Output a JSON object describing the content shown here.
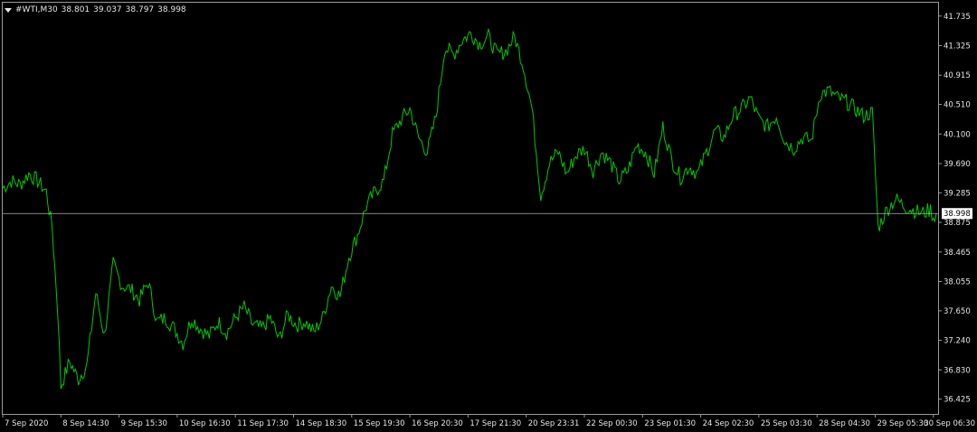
{
  "header": {
    "symbol": "#WTI,M30",
    "ohlc": [
      "38.801",
      "39.037",
      "38.797",
      "38.998"
    ]
  },
  "colors": {
    "background": "#000000",
    "series": "#00c800",
    "text": "#e6e6e6",
    "frame": "#9a9a9a",
    "bid_line": "#b4b4b4",
    "price_tag_bg": "#ffffff",
    "price_tag_text": "#000000"
  },
  "chart_data": {
    "type": "line",
    "title": "#WTI,M30",
    "y_axis_position": "right",
    "grid": false,
    "ylim": [
      36.22,
      41.92
    ],
    "y_ticks": [
      41.735,
      41.325,
      40.915,
      40.51,
      40.1,
      39.69,
      39.285,
      38.875,
      38.465,
      38.055,
      37.65,
      37.24,
      36.83,
      36.425
    ],
    "y_tick_labels": [
      "41.735",
      "41.325",
      "40.915",
      "40.510",
      "40.100",
      "39.690",
      "39.285",
      "38.875",
      "38.465",
      "38.055",
      "37.650",
      "37.240",
      "36.830",
      "36.425"
    ],
    "current_price": 38.998,
    "current_price_label": "38.998",
    "x_tick_labels": [
      "7 Sep 2020",
      "8 Sep 14:30",
      "9 Sep 15:30",
      "10 Sep 16:30",
      "11 Sep 17:30",
      "14 Sep 18:30",
      "15 Sep 19:30",
      "16 Sep 20:30",
      "17 Sep 21:30",
      "20 Sep 23:31",
      "22 Sep 00:30",
      "23 Sep 01:30",
      "24 Sep 02:30",
      "25 Sep 03:30",
      "28 Sep 04:30",
      "29 Sep 05:30",
      "30 Sep 06:30"
    ],
    "x_tick_positions": [
      0,
      1,
      2,
      3,
      4,
      5,
      6,
      7,
      8,
      9,
      10,
      11,
      12,
      13,
      14,
      15,
      16
    ],
    "series": [
      {
        "x": [
          0,
          0.15,
          0.3,
          0.45,
          0.6,
          0.75,
          0.85,
          0.95,
          1.0,
          1.15,
          1.3,
          1.45,
          1.6,
          1.75,
          1.9,
          2.05,
          2.2,
          2.35,
          2.5,
          2.65,
          2.8,
          2.95,
          3.1,
          3.25,
          3.4,
          3.55,
          3.7,
          3.85,
          4.0,
          4.15,
          4.3,
          4.45,
          4.6,
          4.75,
          4.9,
          5.05,
          5.2,
          5.35,
          5.5,
          5.65,
          5.8,
          5.95,
          6.1,
          6.25,
          6.4,
          6.55,
          6.7,
          6.85,
          7.0,
          7.15,
          7.3,
          7.45,
          7.6,
          7.75,
          7.9,
          8.05,
          8.2,
          8.35,
          8.5,
          8.65,
          8.8,
          8.95,
          9.1,
          9.25,
          9.4,
          9.55,
          9.7,
          9.85,
          10.0,
          10.15,
          10.3,
          10.45,
          10.6,
          10.75,
          10.9,
          11.05,
          11.2,
          11.35,
          11.5,
          11.65,
          11.8,
          11.95,
          12.1,
          12.25,
          12.4,
          12.55,
          12.7,
          12.85,
          13.0,
          13.15,
          13.3,
          13.45,
          13.6,
          13.75,
          13.9,
          14.05,
          14.2,
          14.35,
          14.5,
          14.65,
          14.8,
          14.95,
          15.05,
          15.2,
          15.35,
          15.5,
          15.65,
          15.8,
          15.95,
          16.0,
          16.05
        ],
        "values": [
          39.35,
          39.45,
          39.4,
          39.55,
          39.45,
          39.3,
          38.8,
          37.6,
          36.6,
          36.95,
          36.7,
          36.9,
          37.9,
          37.3,
          38.3,
          38.0,
          37.95,
          37.8,
          38.05,
          37.5,
          37.55,
          37.4,
          37.2,
          37.55,
          37.4,
          37.3,
          37.5,
          37.35,
          37.55,
          37.7,
          37.45,
          37.4,
          37.55,
          37.25,
          37.6,
          37.45,
          37.5,
          37.35,
          37.55,
          38.0,
          37.85,
          38.4,
          38.7,
          39.1,
          39.3,
          39.45,
          40.1,
          40.3,
          40.45,
          40.05,
          39.85,
          40.35,
          41.3,
          41.2,
          41.4,
          41.5,
          41.35,
          41.45,
          41.2,
          41.25,
          41.45,
          41.05,
          40.45,
          39.25,
          39.7,
          39.85,
          39.55,
          39.8,
          39.9,
          39.6,
          39.85,
          39.7,
          39.45,
          39.6,
          39.95,
          39.85,
          39.55,
          40.2,
          39.75,
          39.5,
          39.65,
          39.55,
          39.85,
          40.15,
          40.05,
          40.35,
          40.45,
          40.6,
          40.3,
          40.2,
          40.35,
          40.0,
          39.9,
          40.05,
          40.0,
          40.65,
          40.7,
          40.6,
          40.55,
          40.45,
          40.35,
          40.4,
          38.8,
          39.05,
          39.2,
          39.1,
          39.05,
          39.0,
          39.05,
          38.95,
          38.998
        ]
      }
    ]
  }
}
